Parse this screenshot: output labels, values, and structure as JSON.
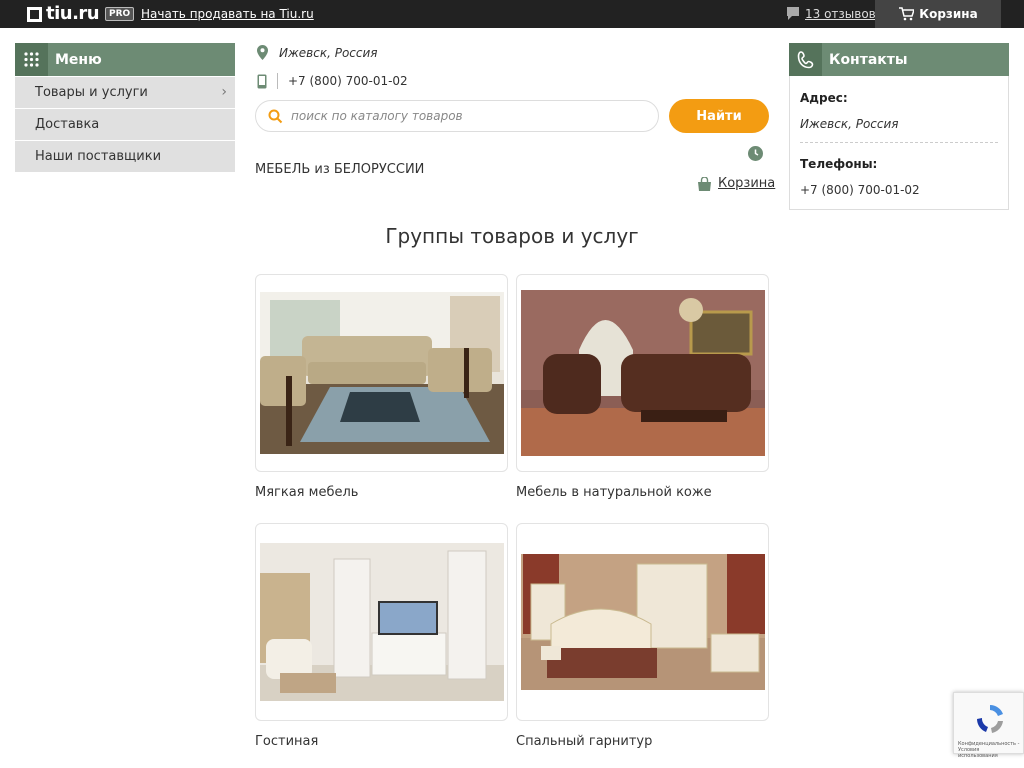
{
  "topbar": {
    "logo": "tiu.ru",
    "pro": "PRO",
    "sell_link": "Начать продавать на Tiu.ru",
    "reviews": "13 отзывов",
    "cart": "Корзина"
  },
  "menu": {
    "title": "Меню",
    "items": [
      {
        "label": "Товары и услуги",
        "has_children": true
      },
      {
        "label": "Доставка",
        "has_children": false
      },
      {
        "label": "Наши поставщики",
        "has_children": false
      }
    ]
  },
  "header": {
    "location": "Ижевск, Россия",
    "phone": "+7 (800) 700-01-02",
    "company": "МЕБЕЛЬ из БЕЛОРУССИИ",
    "cart_link": "Корзина"
  },
  "search": {
    "placeholder": "поиск по каталогу товаров",
    "button": "Найти"
  },
  "groups": {
    "title": "Группы товаров и услуг",
    "items": [
      {
        "label": "Мягкая мебель"
      },
      {
        "label": "Мебель в натуральной коже"
      },
      {
        "label": "Гостиная"
      },
      {
        "label": "Спальный гарнитур"
      }
    ]
  },
  "contacts": {
    "title": "Контакты",
    "address_label": "Адрес:",
    "address": "Ижевск, Россия",
    "phones_label": "Телефоны:",
    "phone": "+7 (800) 700-01-02"
  },
  "recaptcha": {
    "text": "Конфиденциальность - Условия использования"
  },
  "colors": {
    "accent_green": "#6d8b74",
    "button_orange": "#f39c12",
    "topbar": "#222222"
  }
}
